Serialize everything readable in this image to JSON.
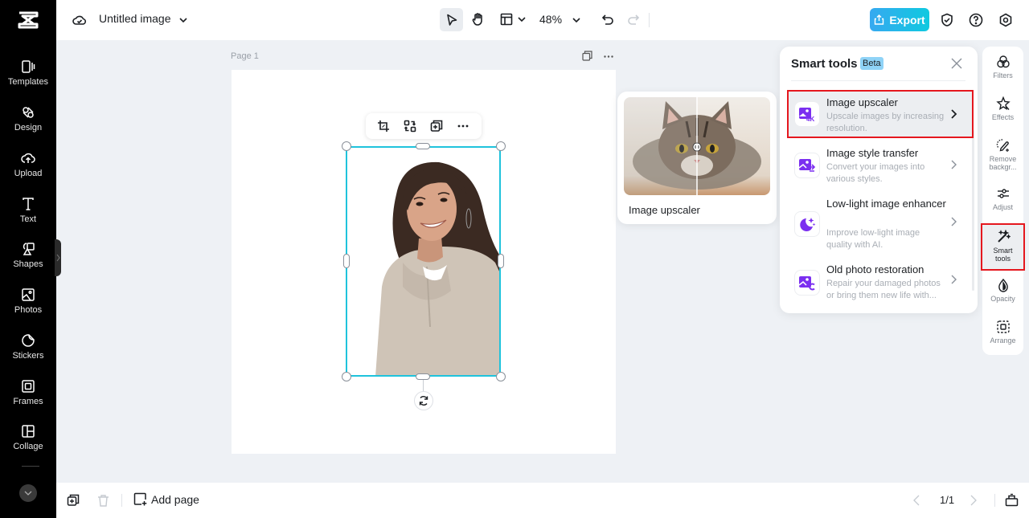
{
  "app": {
    "document_title": "Untitled image",
    "zoom_level": "48%",
    "export_label": "Export"
  },
  "sidebar": {
    "items": [
      {
        "label": "Templates",
        "icon": "templates-icon"
      },
      {
        "label": "Design",
        "icon": "design-icon"
      },
      {
        "label": "Upload",
        "icon": "upload-cloud-icon"
      },
      {
        "label": "Text",
        "icon": "text-icon"
      },
      {
        "label": "Shapes",
        "icon": "shapes-icon"
      },
      {
        "label": "Photos",
        "icon": "photos-icon"
      },
      {
        "label": "Stickers",
        "icon": "stickers-icon"
      },
      {
        "label": "Frames",
        "icon": "frames-icon"
      },
      {
        "label": "Collage",
        "icon": "collage-icon"
      }
    ]
  },
  "canvas": {
    "page_label": "Page 1"
  },
  "preview_card": {
    "label": "Image upscaler"
  },
  "smart_tools": {
    "title": "Smart tools",
    "badge": "Beta",
    "tools": [
      {
        "name": "Image upscaler",
        "description": "Upscale images by increasing resolution.",
        "selected": true
      },
      {
        "name": "Image style transfer",
        "description": "Convert your images into various styles.",
        "selected": false
      },
      {
        "name": "Low-light image enhancer",
        "description": "Improve low-light image quality with AI.",
        "selected": false
      },
      {
        "name": "Old photo restoration",
        "description": "Repair your damaged photos or bring them new life with...",
        "selected": false
      }
    ]
  },
  "right_rail": {
    "items": [
      {
        "label": "Filters"
      },
      {
        "label": "Effects"
      },
      {
        "label": "Remove backgr..."
      },
      {
        "label": "Adjust"
      },
      {
        "label": "Smart tools",
        "active": true
      },
      {
        "label": "Opacity"
      },
      {
        "label": "Arrange"
      }
    ]
  },
  "bottom_bar": {
    "add_page_label": "Add page",
    "page_indicator": "1/1"
  },
  "colors": {
    "accent": "#1fc3dc",
    "highlight": "#e5171e",
    "tool_icon": "#7b2ff0"
  }
}
